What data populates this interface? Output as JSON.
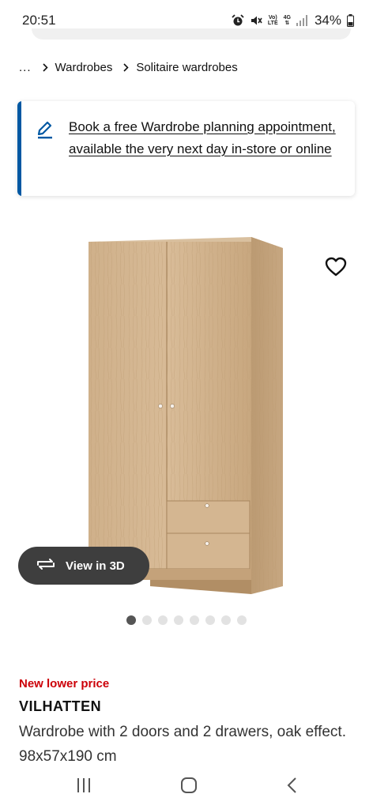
{
  "status_bar": {
    "time": "20:51",
    "network_top": "Vo)",
    "network_bottom": "LTE",
    "net_type_top": "4G",
    "battery": "34%"
  },
  "breadcrumb": {
    "ellipsis": "...",
    "items": [
      "Wardrobes",
      "Solitaire wardrobes"
    ]
  },
  "banner": {
    "accent_color": "#0058a3",
    "text": "Book a free Wardrobe planning appointment, available the very next day in-store or online"
  },
  "gallery": {
    "view_3d_label": "View in 3D",
    "image_count": 8,
    "active_index": 0
  },
  "product": {
    "badge": "New lower price",
    "badge_color": "#cc0008",
    "name": "VILHATTEN",
    "description": "Wardrobe with 2 doors and 2 drawers, oak effect. 98x57x190 cm"
  },
  "icons": {
    "breadcrumb_separator": "chevron-right-icon",
    "banner": "pencil-icon",
    "favourite": "heart-icon",
    "view_3d": "rotate-icon",
    "nav": [
      "recents-icon",
      "home-icon",
      "back-icon"
    ]
  }
}
